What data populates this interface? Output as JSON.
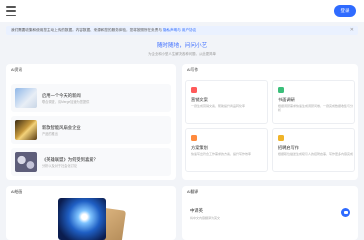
{
  "header": {
    "menu_icon": "hamburger-menu-icon",
    "login_label": "登录"
  },
  "notice": {
    "text": "我们需要收集和使用您主动上传的数据。内容数据、来源和您的服务体验，您将按照所在负责与",
    "link_text": "隐私声明与 用户协议",
    "close_icon": "close-icon"
  },
  "hero": {
    "title": "随时随地，问问小艺",
    "subtitle": "为企业和小型人生解决各种问题，从此更简单"
  },
  "ai_news": {
    "tab_label": "AI资讯",
    "items": [
      {
        "title": "启用一个今天的新闻",
        "desc": "联合调查，请Merge加速为您提供"
      },
      {
        "title": "新款智能风扇会企业",
        "desc": "产品的推出"
      },
      {
        "title": "《英雄联盟》为何受到喜爱？",
        "desc": "分析以及对于社会化讨论"
      }
    ]
  },
  "ai_writing": {
    "tab_label": "AI写作",
    "tools": [
      {
        "title": "营销文案",
        "desc": "一键生成营销文案，帮助提升商品转化率",
        "color": "#ff5a5a"
      },
      {
        "title": "书面调研",
        "desc": "根据调研需求快速生成调研问卷，一键完成数据收集与分析",
        "color": "#3bbf7a"
      },
      {
        "title": "方案策划",
        "desc": "快速写出符合工作需求的方案，提升写作效率",
        "color": "#ff8a3d"
      },
      {
        "title": "招聘启写作",
        "desc": "根据职位描述生成吸引人的招聘启事，写作更多内容完成",
        "color": "#f0b429"
      }
    ]
  },
  "ai_drawing": {
    "tab_label": "AI绘画"
  },
  "ai_translate": {
    "tab_label": "AI翻译",
    "lang_label": "中译英",
    "desc": "将中文内容翻译为英文"
  }
}
